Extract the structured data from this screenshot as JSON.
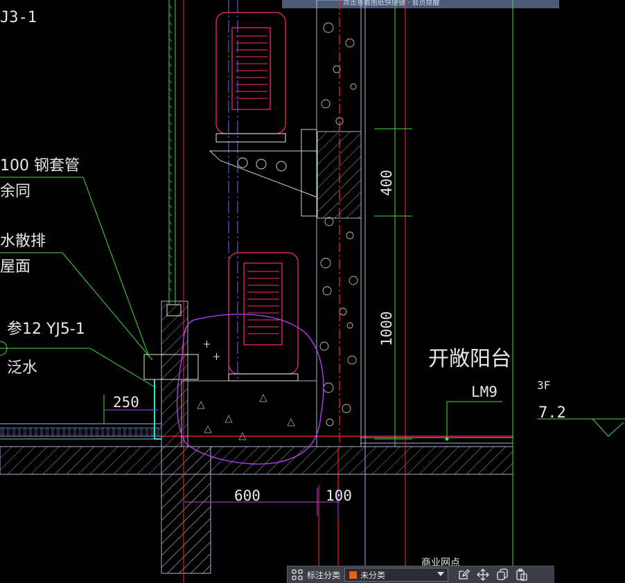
{
  "banner": {
    "text": "点击查看图纸快捷键 · 会员提醒"
  },
  "colors": {
    "background": "#000000",
    "grid_green": "#3fe03f",
    "red_line": "#ff2a2a",
    "wall_outline": "#a8b8d8",
    "magenta": "#ff2a7a",
    "purple": "#c040ff",
    "blue_dim": "#6a6aff",
    "cyan": "#40d8d8",
    "toolbar_swatch": "#e8601c"
  },
  "drawing": {
    "label_partial_top": "J3-1",
    "label_steel_sleeve": "100 钢套管",
    "label_rest_same": "余同",
    "label_water_drain": "水散排",
    "label_roof": "屋面",
    "label_ref": "参12 YJ5-1",
    "label_flashing": "泛水",
    "dim_250": "250",
    "dim_400": "400",
    "dim_1000": "1000",
    "dim_600": "600",
    "dim_100": "100",
    "label_open_balcony": "开敞阳台",
    "label_lm9": "LM9",
    "floor_label": "3F",
    "elevation": "7.2",
    "label_bottom_partial": "商业网点"
  },
  "toolbar": {
    "grid_icon": "grid-icon",
    "category_label": "标注分类",
    "category_value": "未分类",
    "icons": [
      "edit-icon",
      "move-icon",
      "copy-icon",
      "paste-icon"
    ]
  }
}
